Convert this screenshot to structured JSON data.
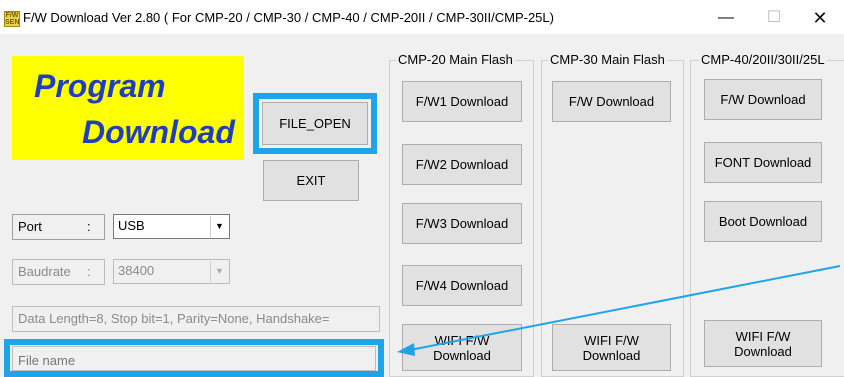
{
  "window": {
    "title": "F/W Download Ver 2.80 ( For CMP-20 / CMP-30 / CMP-40 / CMP-20II / CMP-30II/CMP-25L)",
    "icon_text": "F/W SEND",
    "minimize": "—",
    "maximize": "☐",
    "close": "✕"
  },
  "banner": {
    "line1": "Program",
    "line2": "Download",
    "bg": "#ffff00",
    "text_color": "#1f3fbf"
  },
  "buttons": {
    "file_open": "FILE_OPEN",
    "exit": "EXIT"
  },
  "port": {
    "label": "Port",
    "colon": ":",
    "value": "USB"
  },
  "baudrate": {
    "label": "Baudrate",
    "colon": ":",
    "value": "38400"
  },
  "data_info": "Data Length=8, Stop bit=1, Parity=None, Handshake=",
  "file_name": {
    "placeholder": "File name"
  },
  "groups": {
    "cmp20": {
      "title": "CMP-20 Main Flash",
      "buttons": [
        "F/W1 Download",
        "F/W2 Download",
        "F/W3 Download",
        "F/W4 Download"
      ],
      "wifi_line1": "WIFI F/W",
      "wifi_line2": "Download"
    },
    "cmp30": {
      "title": "CMP-30 Main Flash",
      "fw": "F/W Download",
      "wifi_line1": "WIFI F/W",
      "wifi_line2": "Download"
    },
    "cmp40": {
      "title": "CMP-40/20II/30II/25L",
      "fw": "F/W Download",
      "font": "FONT Download",
      "boot": "Boot Download",
      "wifi_line1": "WIFI F/W",
      "wifi_line2": "Download"
    }
  },
  "colors": {
    "highlight": "#1ea4e9",
    "arrow": "#1ea4e9"
  }
}
